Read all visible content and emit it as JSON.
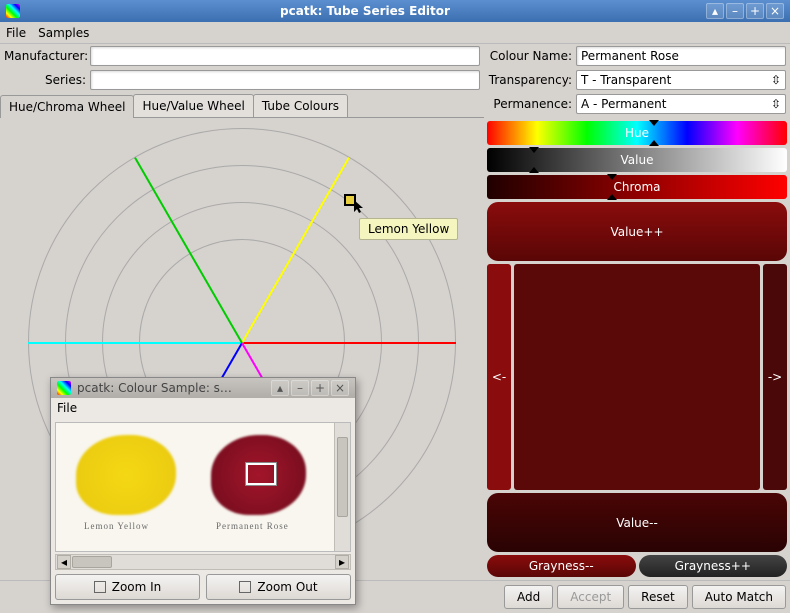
{
  "window": {
    "title": "pcatk: Tube Series Editor"
  },
  "menubar": {
    "file": "File",
    "samples": "Samples"
  },
  "form": {
    "manufacturer_label": "Manufacturer:",
    "manufacturer_value": "",
    "series_label": "Series:",
    "series_value": "",
    "colour_name_label": "Colour Name:",
    "colour_name_value": "Permanent Rose",
    "transparency_label": "Transparency:",
    "transparency_value": "T     - Transparent",
    "permanence_label": "Permanence:",
    "permanence_value": "A     - Permanent"
  },
  "tabs": {
    "hue_chroma": "Hue/Chroma Wheel",
    "hue_value": "Hue/Value Wheel",
    "tube_colours": "Tube Colours"
  },
  "wheel": {
    "tooltip": "Lemon Yellow",
    "marker_color": "#e8d040"
  },
  "sliders": {
    "hue": "Hue",
    "value": "Value",
    "chroma": "Chroma",
    "value_plus": "Value++",
    "value_minus": "Value--",
    "grayness_minus": "Grayness--",
    "grayness_plus": "Grayness++",
    "left_arrow": "<-",
    "right_arrow": "->"
  },
  "bottom": {
    "add": "Add",
    "accept": "Accept",
    "reset": "Reset",
    "auto_match": "Auto Match"
  },
  "sample_window": {
    "title": "pcatk: Colour Sample: s…",
    "file": "File",
    "zoom_in": "Zoom In",
    "zoom_out": "Zoom Out",
    "label_left": "Lemon Yellow",
    "label_right": "Permanent Rose"
  }
}
